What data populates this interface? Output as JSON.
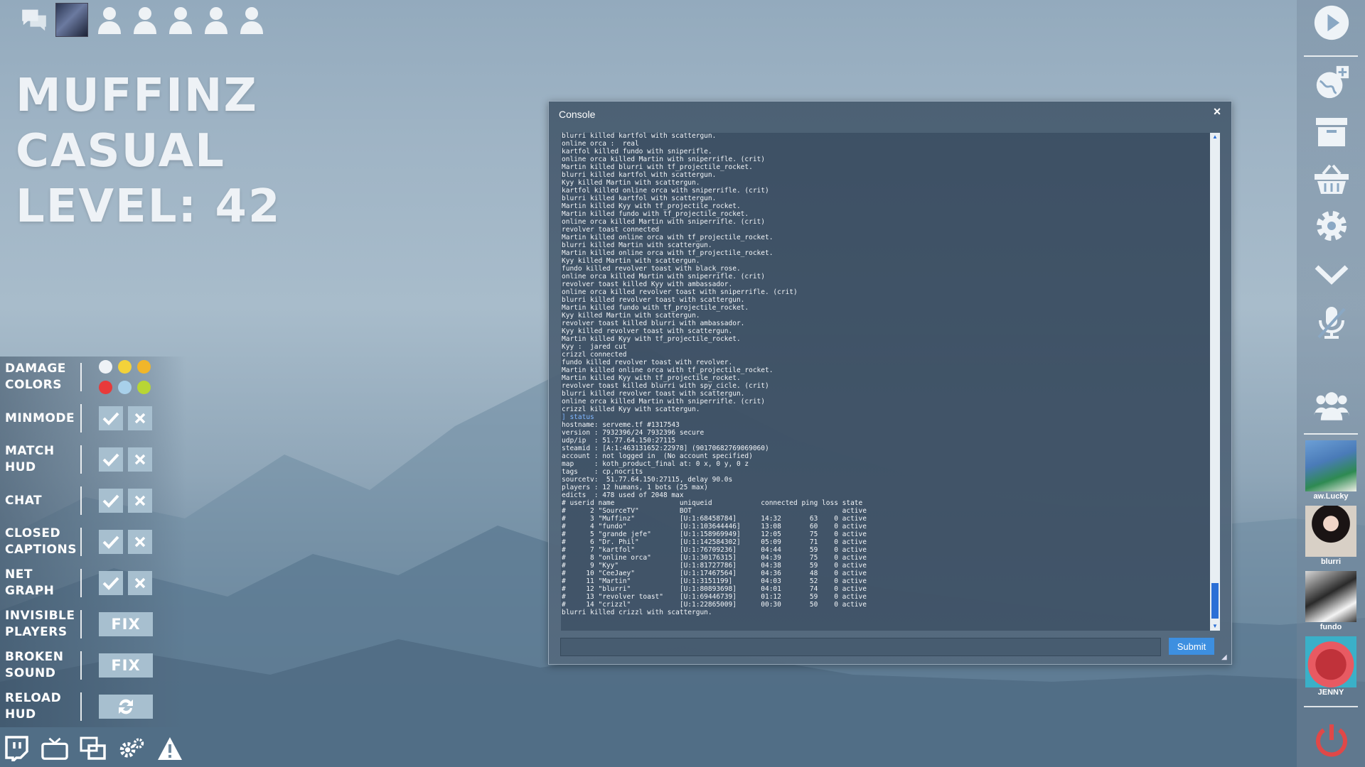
{
  "header": {
    "player_name": "MUFFINZ",
    "mode": "CASUAL",
    "level": "LEVEL: 42"
  },
  "topbar": {
    "icons": [
      "chat-icon",
      "profile-avatar",
      "party-slot-icon",
      "party-slot-icon",
      "party-slot-icon",
      "party-slot-icon",
      "party-slot-icon"
    ]
  },
  "settings": {
    "rows": [
      {
        "label": "DAMAGE\nCOLORS",
        "type": "colors",
        "colors": [
          "#e8eef4",
          "#f3d23a",
          "#f0b62a",
          "#e83a3a",
          "#a8d0ea",
          "#b8d634"
        ]
      },
      {
        "label": "MINMODE",
        "type": "toggle"
      },
      {
        "label": "MATCH\nHUD",
        "type": "toggle"
      },
      {
        "label": "CHAT",
        "type": "toggle"
      },
      {
        "label": "CLOSED\nCAPTIONS",
        "type": "toggle"
      },
      {
        "label": "NET\nGRAPH",
        "type": "toggle"
      },
      {
        "label": "INVISIBLE\nPLAYERS",
        "type": "fix",
        "button": "FIX"
      },
      {
        "label": "BROKEN\nSOUND",
        "type": "fix",
        "button": "FIX"
      },
      {
        "label": "RELOAD\nHUD",
        "type": "reload"
      }
    ]
  },
  "bottombar": {
    "icons": [
      "twitch-icon",
      "tv-icon",
      "windows-icon",
      "advanced-settings-icon",
      "warning-icon"
    ]
  },
  "rail": {
    "friends": [
      {
        "name": "aw.Lucky"
      },
      {
        "name": "blurri"
      },
      {
        "name": "fundo"
      },
      {
        "name": "JENNY"
      }
    ]
  },
  "console": {
    "title": "Console",
    "close": "×",
    "submit": "Submit",
    "input_value": "",
    "lines": [
      "blurri killed kartfol with scattergun.",
      "online orca :  real",
      "kartfol killed fundo with sniperifle.",
      "online orca killed Martin with sniperrifle. (crit)",
      "Martin killed blurri with tf_projectile_rocket.",
      "blurri killed kartfol with scattergun.",
      "Kyy killed Martin with scattergun.",
      "kartfol killed online orca with sniperrifle. (crit)",
      "blurri killed kartfol with scattergun.",
      "Martin killed Kyy with tf_projectile_rocket.",
      "Martin killed fundo with tf_projectile_rocket.",
      "online orca killed Martin with sniperrifle. (crit)",
      "revolver toast connected",
      "Martin killed online orca with tf_projectile_rocket.",
      "blurri killed Martin with scattergun.",
      "Martin killed online orca with tf_projectile_rocket.",
      "Kyy killed Martin with scattergun.",
      "fundo killed revolver toast with black_rose.",
      "online orca killed Martin with sniperrifle. (crit)",
      "revolver toast killed Kyy with ambassador.",
      "online orca killed revolver toast with sniperrifle. (crit)",
      "blurri killed revolver toast with scattergun.",
      "Martin killed fundo with tf_projectile_rocket.",
      "Kyy killed Martin with scattergun.",
      "revolver toast killed blurri with ambassador.",
      "Kyy killed revolver toast with scattergun.",
      "Martin killed Kyy with tf_projectile_rocket.",
      "Kyy :  jared cut",
      "crizzl connected",
      "fundo killed revolver toast with revolver.",
      "Martin killed online orca with tf_projectile_rocket.",
      "Martin killed Kyy with tf_projectile_rocket.",
      "revolver toast killed blurri with spy_cicle. (crit)",
      "blurri killed revolver toast with scattergun.",
      "online orca killed Martin with sniperrifle. (crit)",
      "crizzl killed Kyy with scattergun.",
      "] status",
      "hostname: serveme.tf #1317543",
      "version : 7932396/24 7932396 secure",
      "udp/ip  : 51.77.64.150:27115",
      "steamid : [A:1:463131652:22978] (90170682769069060)",
      "account : not logged in  (No account specified)",
      "map     : koth_product_final at: 0 x, 0 y, 0 z",
      "tags    : cp,nocrits",
      "sourcetv:  51.77.64.150:27115, delay 90.0s",
      "players : 12 humans, 1 bots (25 max)",
      "edicts  : 478 used of 2048 max",
      "# userid name                uniqueid            connected ping loss state",
      "#      2 \"SourceTV\"          BOT                                     active",
      "#      3 \"Muffinz\"           [U:1:68458784]      14:32       63    0 active",
      "#      4 \"fundo\"             [U:1:103644446]     13:08       60    0 active",
      "#      5 \"grande jefe\"       [U:1:158969949]     12:05       75    0 active",
      "#      6 \"Dr. Phil\"          [U:1:142584302]     05:09       71    0 active",
      "#      7 \"kartfol\"           [U:1:76709236]      04:44       59    0 active",
      "#      8 \"online orca\"       [U:1:30176315]      04:39       75    0 active",
      "#      9 \"Kyy\"               [U:1:81727786]      04:38       59    0 active",
      "#     10 \"CeeJaey\"           [U:1:17467564]      04:36       48    0 active",
      "#     11 \"Martin\"            [U:1:3151199]       04:03       52    0 active",
      "#     12 \"blurri\"            [U:1:80893698]      04:01       74    0 active",
      "#     13 \"revolver toast\"    [U:1:69446739]      01:12       59    0 active",
      "#     14 \"crizzl\"            [U:1:22865009]      00:30       50    0 active",
      "blurri killed crizzl with scattergun."
    ],
    "highlight_line": "] status"
  },
  "colors": {
    "check": "#ffffff",
    "accent_blue": "#3d8fe0",
    "power_red": "#e04848"
  }
}
